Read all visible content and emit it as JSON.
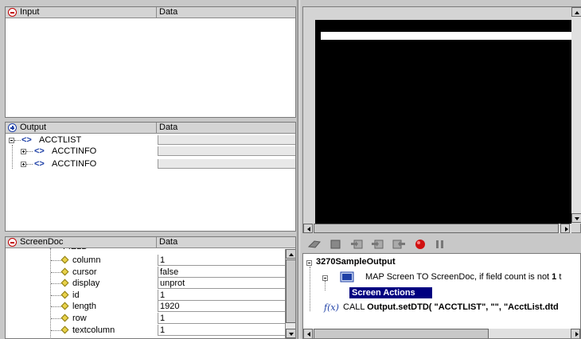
{
  "input_panel": {
    "col_name": "Input",
    "col_data": "Data"
  },
  "output_panel": {
    "col_name": "Output",
    "col_data": "Data",
    "rows": [
      {
        "label": "ACCTLIST"
      },
      {
        "label": "ACCTINFO"
      },
      {
        "label": "ACCTINFO"
      }
    ]
  },
  "screendoc_panel": {
    "col_name": "ScreenDoc",
    "col_data": "Data",
    "partial_label": "FIELD",
    "fields": [
      {
        "name": "column",
        "value": "1"
      },
      {
        "name": "cursor",
        "value": "false"
      },
      {
        "name": "display",
        "value": "unprot"
      },
      {
        "name": "id",
        "value": "1"
      },
      {
        "name": "length",
        "value": "1920"
      },
      {
        "name": "row",
        "value": "1"
      },
      {
        "name": "textcolumn",
        "value": "1"
      }
    ]
  },
  "toolbar": {
    "icons": [
      "eraser-icon",
      "stop-square-icon",
      "step-into-icon",
      "step-over-icon",
      "step-out-icon",
      "record-icon",
      "pause-icon"
    ]
  },
  "script_tree": {
    "root": "3270SampleOutput",
    "map_prefix": "MAP Screen TO ScreenDoc, if field count is not ",
    "map_bold": "1",
    "map_suffix": " t",
    "selected": "Screen Actions",
    "fx_label": "f(x)",
    "call_prefix": "CALL ",
    "call_bold": "Output.setDTD( \"ACCTLIST\", \"\", \"AcctList.dtd"
  },
  "colors": {
    "terminal_bg": "#000000",
    "selection_bg": "#000080",
    "accent_blue": "#1d3fa6",
    "record_red": "#d01010"
  }
}
